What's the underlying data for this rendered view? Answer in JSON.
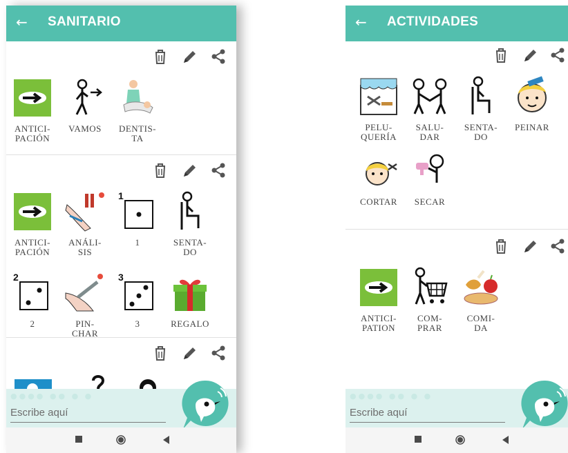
{
  "phones": [
    {
      "title": "SANITARIO",
      "input_placeholder": "Escribe aquí",
      "boards": [
        {
          "tiles": [
            {
              "label": "ANTICI-\nPACIÓN",
              "icon": "anticipation-icon"
            },
            {
              "label": "VAMOS",
              "icon": "go-icon"
            },
            {
              "label": "DENTIS-\nTA",
              "icon": "dentist-icon"
            }
          ]
        },
        {
          "tiles": [
            {
              "label": "ANTICI-\nPACIÓN",
              "icon": "anticipation-icon"
            },
            {
              "label": "ANÁLI-\nSIS",
              "icon": "blood-test-icon"
            },
            {
              "label": "1",
              "icon": "dice-one-icon"
            },
            {
              "label": "SENTA-\nDO",
              "icon": "seated-icon"
            },
            {
              "label": "2",
              "icon": "dice-two-icon"
            },
            {
              "label": "PIN-\nCHAR",
              "icon": "injection-icon"
            },
            {
              "label": "3",
              "icon": "dice-three-icon"
            },
            {
              "label": "REGALO",
              "icon": "gift-icon"
            }
          ]
        },
        {
          "tiles": []
        }
      ]
    },
    {
      "title": "ACTIVIDADES",
      "input_placeholder": "Escribe aquí",
      "boards": [
        {
          "tiles": [
            {
              "label": "PELU-\nQUERÍA",
              "icon": "hairdresser-icon"
            },
            {
              "label": "SALU-\nDAR",
              "icon": "greet-icon"
            },
            {
              "label": "SENTA-\nDO",
              "icon": "seated-icon"
            },
            {
              "label": "PEINAR",
              "icon": "comb-hair-icon"
            },
            {
              "label": "CORTAR",
              "icon": "haircut-icon"
            },
            {
              "label": "SECAR",
              "icon": "hair-dryer-icon"
            }
          ]
        },
        {
          "tiles": [
            {
              "label": "ANTICI-\nPATION",
              "icon": "anticipation-icon"
            },
            {
              "label": "COM-\nPRAR",
              "icon": "shopping-cart-icon"
            },
            {
              "label": "COMI-\nDA",
              "icon": "food-icon"
            }
          ]
        }
      ]
    }
  ],
  "colors": {
    "app_bar": "#53bfae",
    "input_bar": "#dcf1ee",
    "fab": "#53bfae",
    "text": "#444444"
  },
  "nav_icons": [
    "recent-apps-icon",
    "home-icon",
    "back-nav-icon"
  ]
}
